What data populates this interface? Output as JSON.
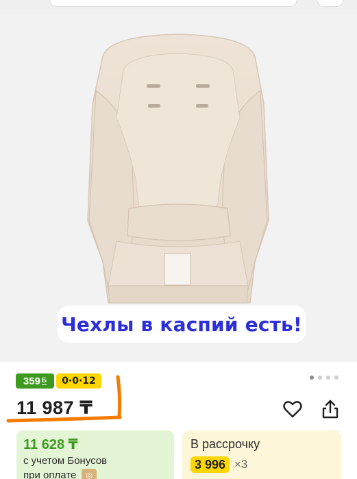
{
  "gallery": {
    "caption": "Чехлы в каспий есть!",
    "slide_count": 4,
    "active_slide": 1
  },
  "badges": {
    "bonus": "359",
    "bonus_sign": "Б",
    "installment": "0·0·12"
  },
  "price": {
    "value": "11 987 ₸"
  },
  "actions": {
    "favorite_icon": "heart-icon",
    "share_icon": "share-icon"
  },
  "bonus_card": {
    "price": "11 628 ₸",
    "line1": "с учетом Бонусов",
    "line2": "при оплате"
  },
  "credit_card": {
    "title": "В рассрочку",
    "monthly": "3 996",
    "times": "×3"
  },
  "colors": {
    "caption_text": "#2c2ed8",
    "bonus_green": "#3d9a1f",
    "installment_yellow": "#ffd700",
    "underline_orange": "#f57c00"
  }
}
